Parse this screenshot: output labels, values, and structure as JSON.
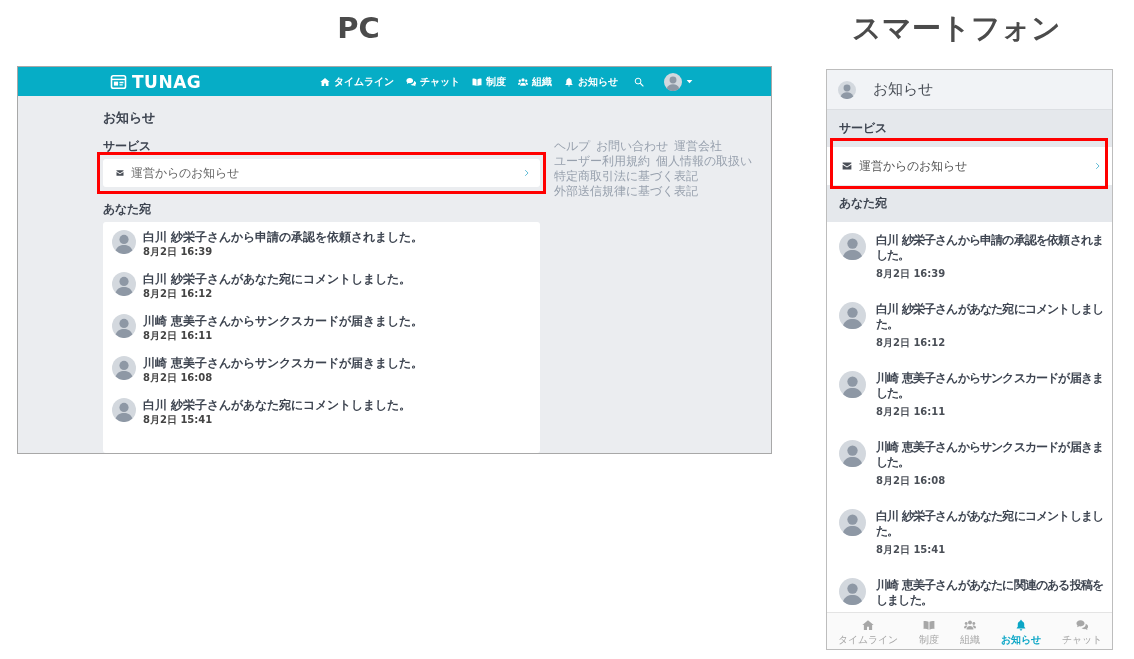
{
  "pc": {
    "heading": "PC",
    "header": {
      "logo": "TUNAG",
      "nav": [
        {
          "kind": "timeline",
          "label": "タイムライン"
        },
        {
          "kind": "chat",
          "label": "チャット"
        },
        {
          "kind": "system",
          "label": "制度"
        },
        {
          "kind": "organization",
          "label": "組織"
        },
        {
          "kind": "notifications",
          "label": "お知らせ"
        }
      ]
    },
    "page_title": "お知らせ",
    "services": {
      "heading": "サービス",
      "items": [
        {
          "label": "運営からのお知らせ",
          "highlighted": true
        }
      ]
    },
    "to_you": {
      "heading": "あなた宛",
      "items": [
        {
          "text": "白川 紗栄子さんから申請の承認を依頼されました。",
          "time": "8月2日 16:39"
        },
        {
          "text": "白川 紗栄子さんがあなた宛にコメントしました。",
          "time": "8月2日 16:12"
        },
        {
          "text": "川崎 恵美子さんからサンクスカードが届きました。",
          "time": "8月2日 16:11"
        },
        {
          "text": "川崎 恵美子さんからサンクスカードが届きました。",
          "time": "8月2日 16:08"
        },
        {
          "text": "白川 紗栄子さんがあなた宛にコメントしました。",
          "time": "8月2日 15:41"
        }
      ]
    },
    "footer_links": [
      [
        "ヘルプ",
        "お問い合わせ",
        "運営会社"
      ],
      [
        "ユーザー利用規約",
        "個人情報の取扱い"
      ],
      [
        "特定商取引法に基づく表記"
      ],
      [
        "外部送信規律に基づく表記"
      ]
    ]
  },
  "smartphone": {
    "heading": "スマートフォン",
    "title": "お知らせ",
    "services": {
      "heading": "サービス",
      "items": [
        {
          "label": "運営からのお知らせ",
          "highlighted": true
        }
      ]
    },
    "to_you": {
      "heading": "あなた宛",
      "items": [
        {
          "text": "白川 紗栄子さんから申請の承認を依頼されました。",
          "time": "8月2日 16:39"
        },
        {
          "text": "白川 紗栄子さんがあなた宛にコメントしました。",
          "time": "8月2日 16:12"
        },
        {
          "text": "川崎 恵美子さんからサンクスカードが届きました。",
          "time": "8月2日 16:11"
        },
        {
          "text": "川崎 恵美子さんからサンクスカードが届きました。",
          "time": "8月2日 16:08"
        },
        {
          "text": "白川 紗栄子さんがあなた宛にコメントしました。",
          "time": "8月2日 15:41"
        },
        {
          "text": "川崎 恵美子さんがあなたに関連のある投稿をしました。"
        }
      ]
    },
    "tab_bar": [
      {
        "kind": "timeline",
        "label": "タイムライン",
        "selected": false
      },
      {
        "kind": "system",
        "label": "制度",
        "selected": false
      },
      {
        "kind": "organization",
        "label": "組織",
        "selected": false
      },
      {
        "kind": "notifications",
        "label": "お知らせ",
        "selected": true
      },
      {
        "kind": "chat",
        "label": "チャット",
        "selected": false
      }
    ]
  }
}
